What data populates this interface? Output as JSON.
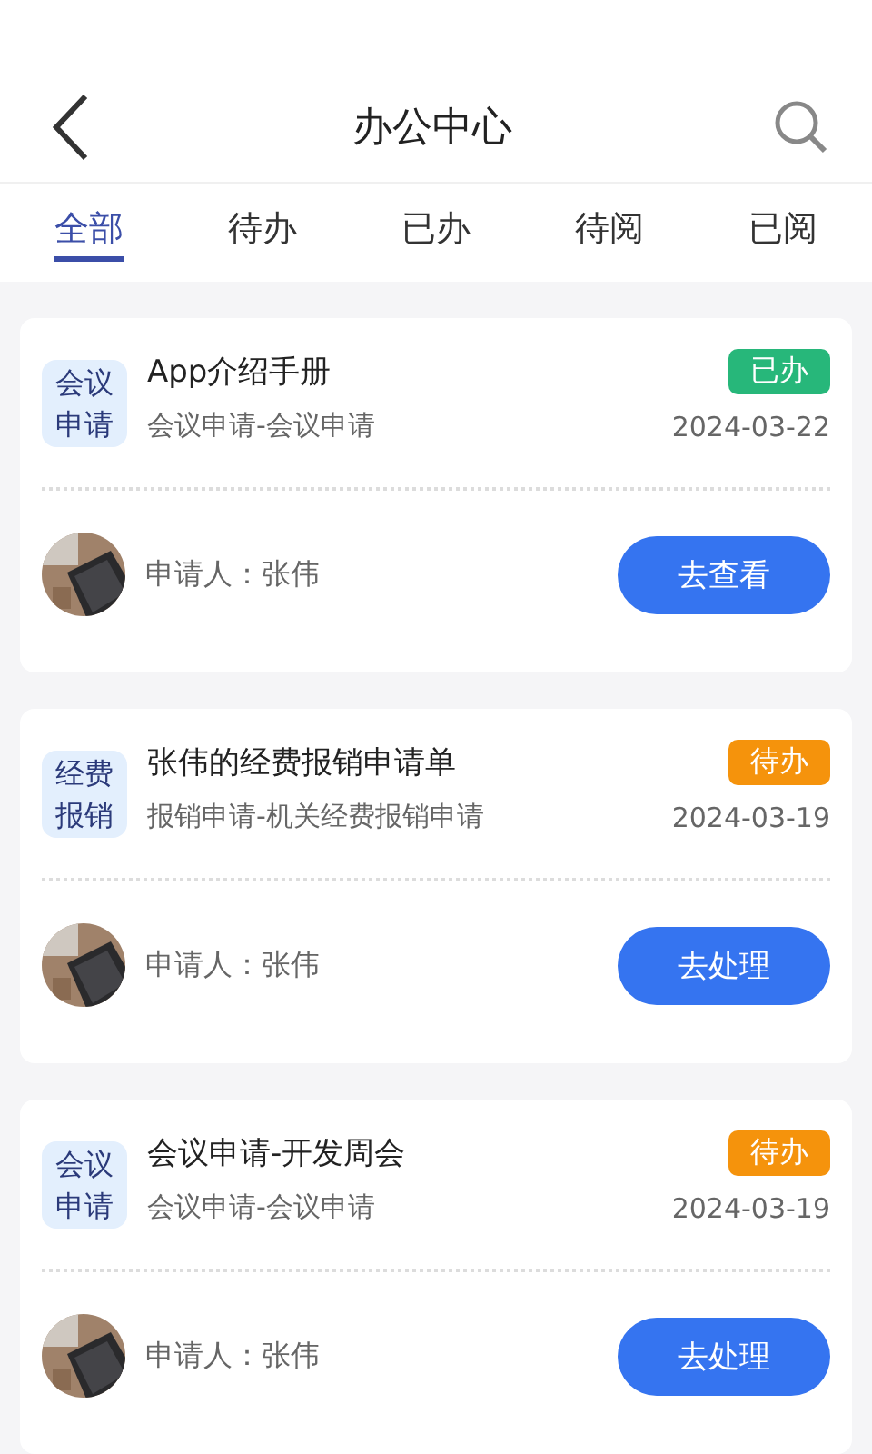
{
  "header": {
    "title": "办公中心"
  },
  "tabs": [
    {
      "label": "全部",
      "selected": true
    },
    {
      "label": "待办",
      "selected": false
    },
    {
      "label": "已办",
      "selected": false
    },
    {
      "label": "待阅",
      "selected": false
    },
    {
      "label": "已阅",
      "selected": false
    }
  ],
  "cards": [
    {
      "type_tag": "会议申请",
      "title": "App介绍手册",
      "status": {
        "label": "已办",
        "kind": "done"
      },
      "subtitle": "会议申请-会议申请",
      "date": "2024-03-22",
      "applicant": "申请人：张伟",
      "action": "去查看"
    },
    {
      "type_tag": "经费报销",
      "title": "张伟的经费报销申请单",
      "status": {
        "label": "待办",
        "kind": "pending"
      },
      "subtitle": "报销申请-机关经费报销申请",
      "date": "2024-03-19",
      "applicant": "申请人：张伟",
      "action": "去处理"
    },
    {
      "type_tag": "会议申请",
      "title": "会议申请-开发周会",
      "status": {
        "label": "待办",
        "kind": "pending"
      },
      "subtitle": "会议申请-会议申请",
      "date": "2024-03-19",
      "applicant": "申请人：张伟",
      "action": "去处理"
    }
  ]
}
